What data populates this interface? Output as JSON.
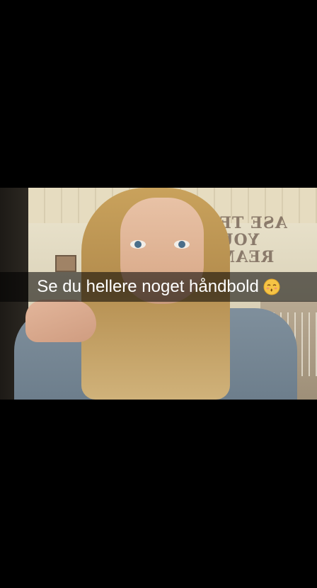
{
  "snap": {
    "caption": "Se du hellere noget håndbold",
    "caption_emoji": "kissing-face-closed-eyes-icon",
    "wall_text": "ASE TER YOUR REAMS"
  },
  "colors": {
    "background": "#000000",
    "caption_bar": "rgba(0,0,0,0.55)",
    "caption_text": "#ffffff"
  }
}
